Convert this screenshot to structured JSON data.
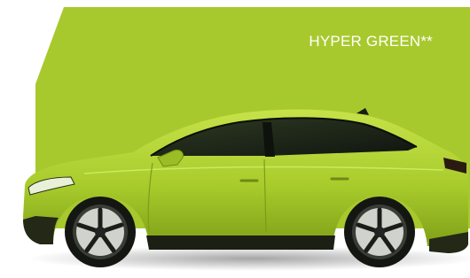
{
  "swatch": {
    "name": "HYPER GREEN**",
    "color": "#a8c92d",
    "body_color": "#b3d43b",
    "body_shadow": "#8fb020"
  },
  "vehicle": {
    "icon": "car-image"
  }
}
